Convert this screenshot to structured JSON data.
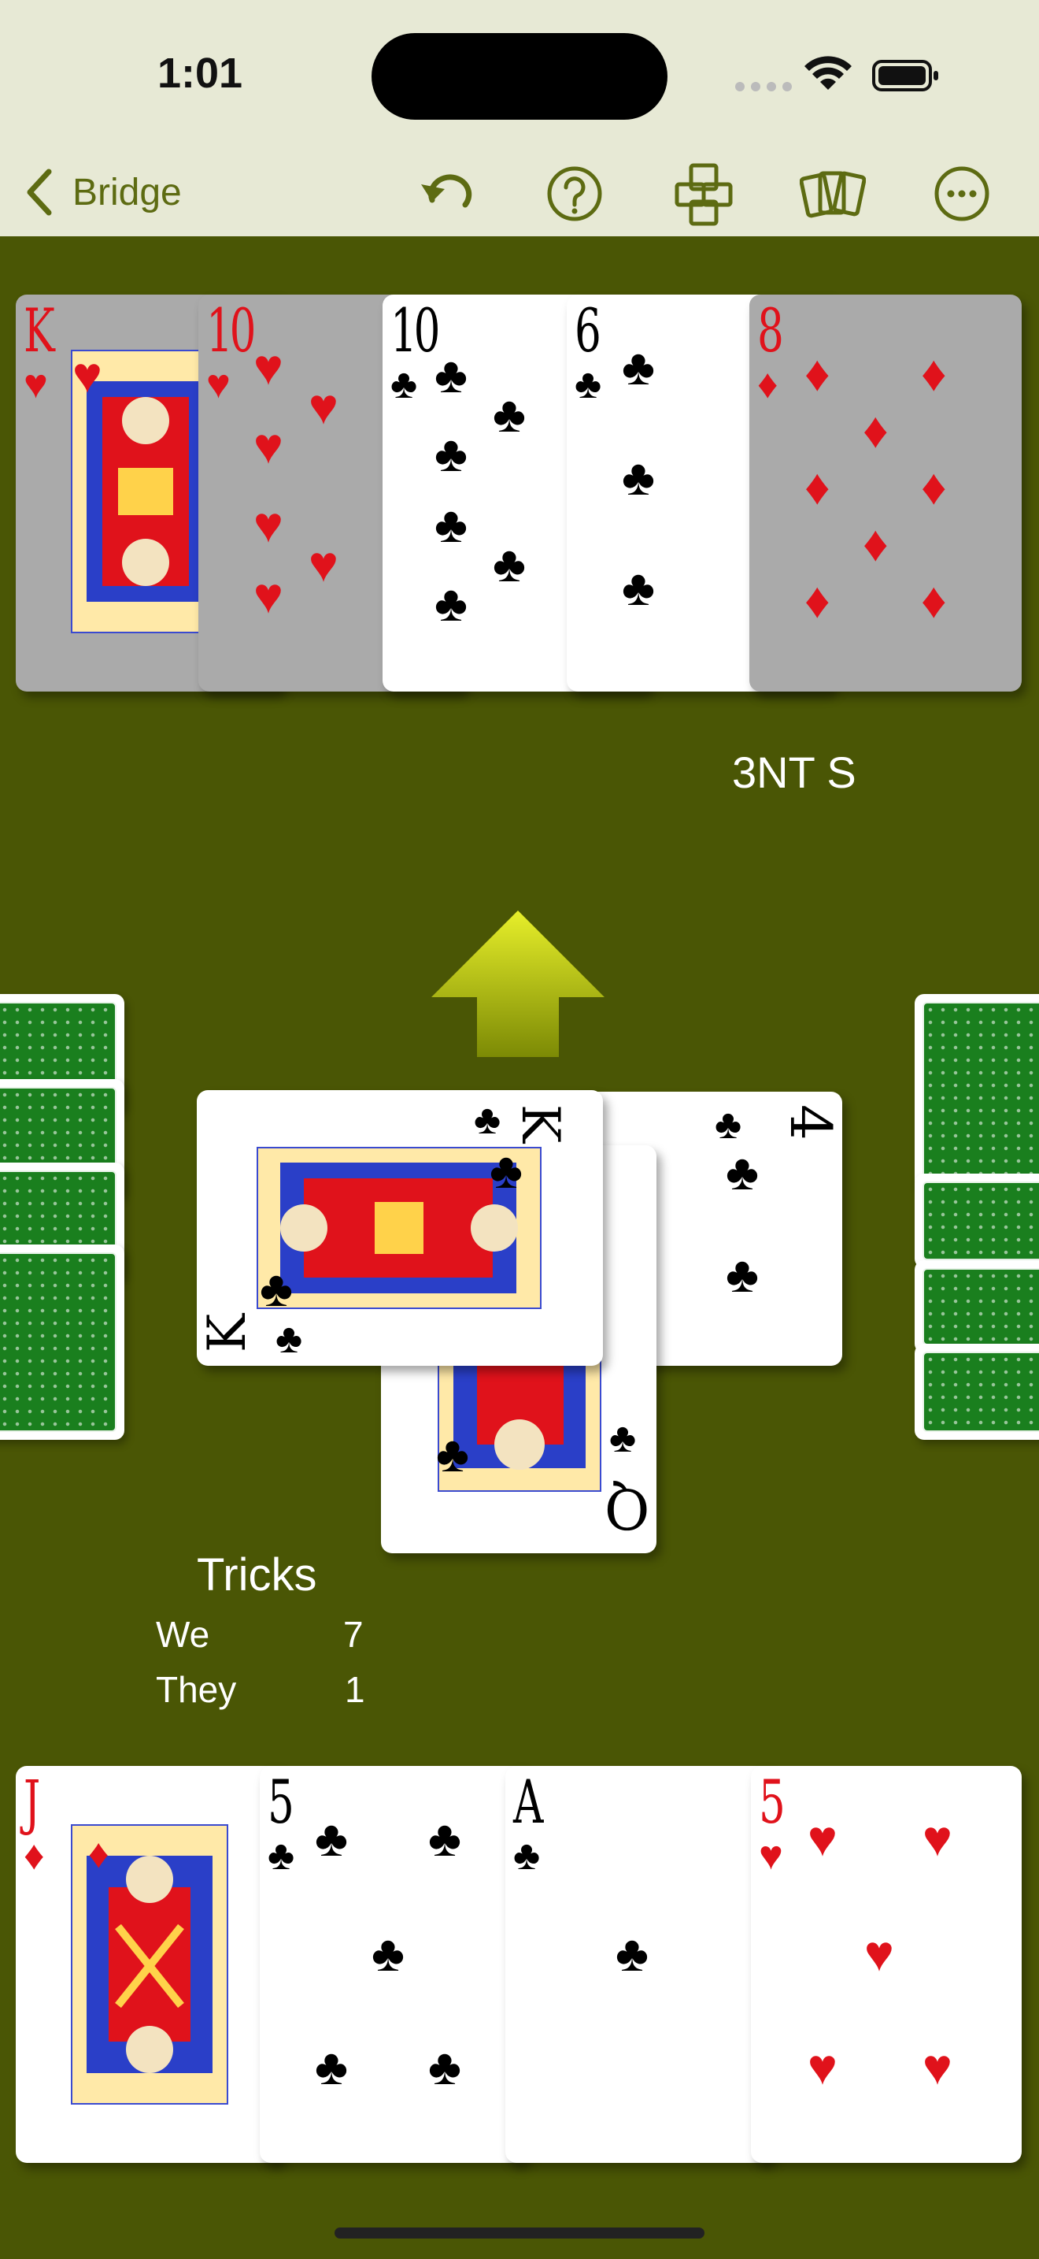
{
  "status_bar": {
    "time": "1:01"
  },
  "nav": {
    "back_label": "Bridge",
    "icons": [
      "undo-icon",
      "help-icon",
      "layout-icon",
      "cards-icon",
      "more-icon"
    ]
  },
  "colors": {
    "felt": "#4a5605",
    "bar": "#e7e9d5",
    "accent": "#5d6b12",
    "red_suit": "#e0121b"
  },
  "dummy_hand": {
    "cards": [
      {
        "rank": "K",
        "suit": "♥",
        "color": "red"
      },
      {
        "rank": "10",
        "suit": "♥",
        "color": "red"
      },
      {
        "rank": "10",
        "suit": "♣",
        "color": "black"
      },
      {
        "rank": "6",
        "suit": "♣",
        "color": "black"
      },
      {
        "rank": "8",
        "suit": "♦",
        "color": "red"
      }
    ]
  },
  "contract": "3NT S",
  "trick": {
    "cards": [
      {
        "rank": "4",
        "suit": "♣",
        "color": "black"
      },
      {
        "rank": "Q",
        "suit": "♣",
        "color": "black"
      },
      {
        "rank": "K",
        "suit": "♣",
        "color": "black"
      }
    ]
  },
  "tricks": {
    "title": "Tricks",
    "we_label": "We",
    "we_value": "7",
    "they_label": "They",
    "they_value": "1"
  },
  "player_hand": {
    "cards": [
      {
        "rank": "J",
        "suit": "♦",
        "color": "red"
      },
      {
        "rank": "5",
        "suit": "♣",
        "color": "black"
      },
      {
        "rank": "A",
        "suit": "♣",
        "color": "black"
      },
      {
        "rank": "5",
        "suit": "♥",
        "color": "red"
      }
    ]
  }
}
